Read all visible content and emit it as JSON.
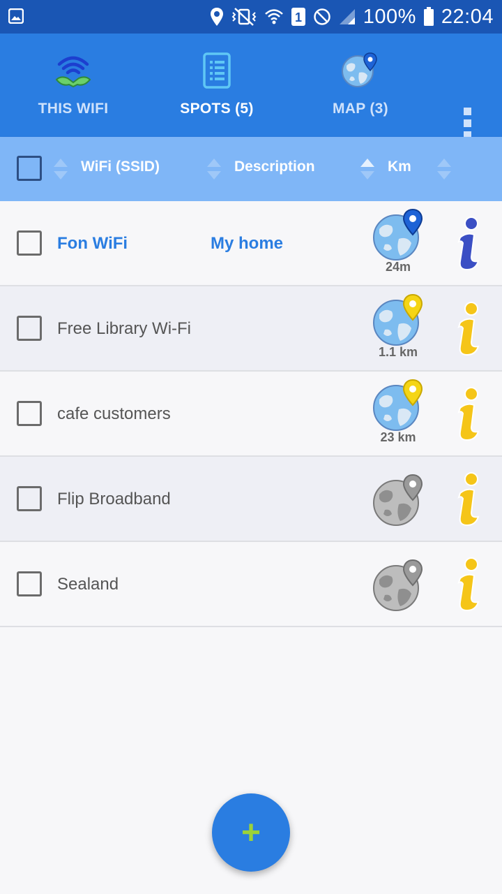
{
  "status_bar": {
    "battery_text": "100%",
    "time": "22:04",
    "sim_slot": "1"
  },
  "tabs": [
    {
      "label": "THIS WIFI",
      "icon": "wifi-signal-icon",
      "active": false
    },
    {
      "label": "SPOTS (5)",
      "icon": "list-document-icon",
      "active": true
    },
    {
      "label": "MAP (3)",
      "icon": "globe-pin-icon",
      "active": false
    }
  ],
  "header": {
    "ssid_label": "WiFi (SSID)",
    "description_label": "Description",
    "km_label": "Km"
  },
  "rows": [
    {
      "ssid": "Fon WiFi",
      "description": "My home",
      "distance": "24m",
      "pin_color": "#1e63d6",
      "globe": "blue",
      "info_color": "#3b4fc4"
    },
    {
      "ssid": "Free Library Wi-Fi",
      "description": "",
      "distance": "1.1 km",
      "pin_color": "#f5d515",
      "globe": "blue",
      "info_color": "#f5c518"
    },
    {
      "ssid": "cafe customers",
      "description": "",
      "distance": "23 km",
      "pin_color": "#f5d515",
      "globe": "blue",
      "info_color": "#f5c518"
    },
    {
      "ssid": "Flip Broadband",
      "description": "",
      "distance": "",
      "pin_color": "#9a9a9a",
      "globe": "gray",
      "info_color": "#f5c518"
    },
    {
      "ssid": "Sealand",
      "description": "",
      "distance": "",
      "pin_color": "#9a9a9a",
      "globe": "gray",
      "info_color": "#f5c518"
    }
  ],
  "fab": {
    "label": "+"
  },
  "colors": {
    "app_bar": "#2a7de1",
    "status_bar": "#1a56b4",
    "header": "#7fb6f7",
    "accent_green": "#9bd23a"
  }
}
